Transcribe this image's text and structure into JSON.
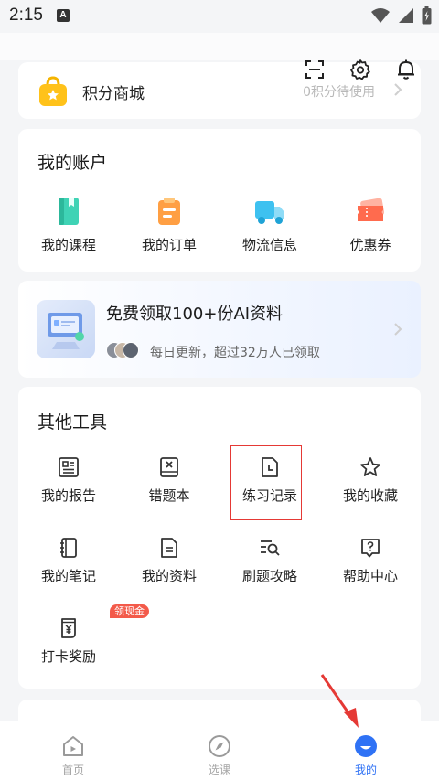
{
  "status_bar": {
    "time": "2:15",
    "notif_letter": "A"
  },
  "points": {
    "title": "积分商城",
    "hint": "0积分待使用"
  },
  "account": {
    "title": "我的账户",
    "items": [
      {
        "label": "我的课程",
        "icon": "course-book-icon",
        "color": "#3fd3b5"
      },
      {
        "label": "我的订单",
        "icon": "order-clipboard-icon",
        "color": "#ff9f43"
      },
      {
        "label": "物流信息",
        "icon": "delivery-truck-icon",
        "color": "#3ec1f0"
      },
      {
        "label": "优惠券",
        "icon": "coupon-ticket-icon",
        "color": "#ff6b4e"
      }
    ]
  },
  "banner": {
    "title": "免费领取100+份AI资料",
    "subtitle": "每日更新，超过32万人已领取"
  },
  "tools": {
    "title": "其他工具",
    "items": [
      {
        "label": "我的报告",
        "icon": "report-icon"
      },
      {
        "label": "错题本",
        "icon": "wrong-question-book-icon"
      },
      {
        "label": "练习记录",
        "icon": "practice-record-icon"
      },
      {
        "label": "我的收藏",
        "icon": "star-icon"
      },
      {
        "label": "我的笔记",
        "icon": "notebook-icon"
      },
      {
        "label": "我的资料",
        "icon": "document-icon"
      },
      {
        "label": "刷题攻略",
        "icon": "search-list-icon"
      },
      {
        "label": "帮助中心",
        "icon": "help-icon"
      },
      {
        "label": "打卡奖励",
        "icon": "checkin-reward-icon",
        "badge": "领现金"
      }
    ]
  },
  "tabbar": {
    "items": [
      {
        "label": "首页",
        "icon": "home-icon",
        "active": false
      },
      {
        "label": "选课",
        "icon": "compass-icon",
        "active": false
      },
      {
        "label": "我的",
        "icon": "profile-icon",
        "active": true
      }
    ]
  },
  "colors": {
    "accent": "#2f72f5",
    "highlight": "#e53935",
    "badge": "#f35a4a"
  }
}
